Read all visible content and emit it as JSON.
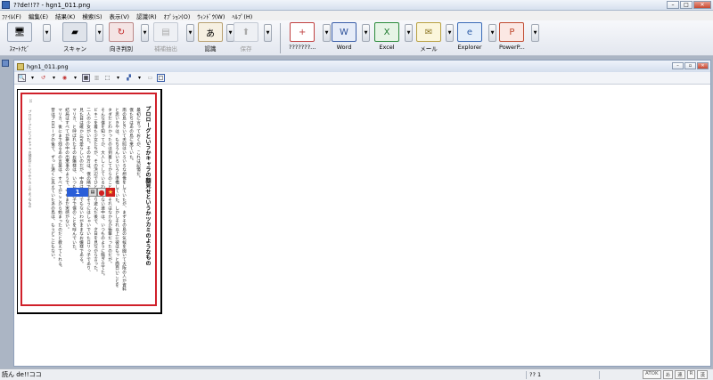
{
  "window": {
    "title": "??de!!?? - hgn1_011.png"
  },
  "menu": [
    "ﾌｧｲﾙ(F)",
    "編集(E)",
    "結果(K)",
    "検索(S)",
    "表示(V)",
    "認識(R)",
    "ｵﾌﾟｼｮﾝ(O)",
    "ｳｨﾝﾄﾞｳ(W)",
    "ﾍﾙﾌﾟ(H)"
  ],
  "toolbar": {
    "smartnavi": "ｽﾏｰﾄﾅﾋﾞ",
    "scan": "スキャン",
    "orientation": "向き判別",
    "correction": "補補抽出",
    "recognize": "認識",
    "save": "保存",
    "unknown": "???????...",
    "word": "Word",
    "excel": "Excel",
    "mail": "メール",
    "explorer": "Explorer",
    "powerpoint": "PowerP..."
  },
  "document": {
    "tab_title": "hgn1_011.png",
    "header_line": "11　　プロローグというかキャラの顔見せというかツカミのようなもの",
    "chapter_title": "プロローグというかキャラの顔見せというかツカミのようなもの",
    "columns": [
      "最初に言っておくが、これは記憶だ。",
      "僕たちはあの島に来ていた。",
      "南の島ときいて天照はいろいろな想像をしていたが、まずその島の気候を聞いて大阪の人が資料",
      "と思いきやは、もちろんいろいろと準備していた。しかしそれ以上に彼はもっと面白いことを",
      "タダだとわかったのは到着してからのことで、それはなかなか衝撃だったのだが。",
      "そんな僕を知ってか、大人しくしているわけもない連中は、いつものように騒ぎ立てた。",
      "ビキニを着た少女たちが、その浜辺でひとしきり遊んだ後で、夕日を見ながら言った。",
      "二人の少女がいた。その片方は、僕の隣で楽しそうにはしゃいでいたロリっ子であり、",
      "見た目は確かに可愛らしいのだが、中身はとんでもないわがままなお嬢様である。",
      "マリカ、と呼ばれたそのお嬢様は、いつもの調子で僕のことを呼んでいた。",
      "結局はすべてが夢の中の出来事のようで、今もまだ実感がない。",
      "マリカ、後にまで残るあの言葉は、すべてがここから始まったのだと教えてくれる。",
      "昔はプロローグの後で、ずっと遠くに見えていたあの島は、もうどこにもない。"
    ],
    "tag_number": "1"
  },
  "status": {
    "left": "読ん de!!ココ",
    "mid": "?? 1",
    "ime": [
      "ATOK",
      "あ",
      "連",
      "R",
      "漢"
    ]
  }
}
